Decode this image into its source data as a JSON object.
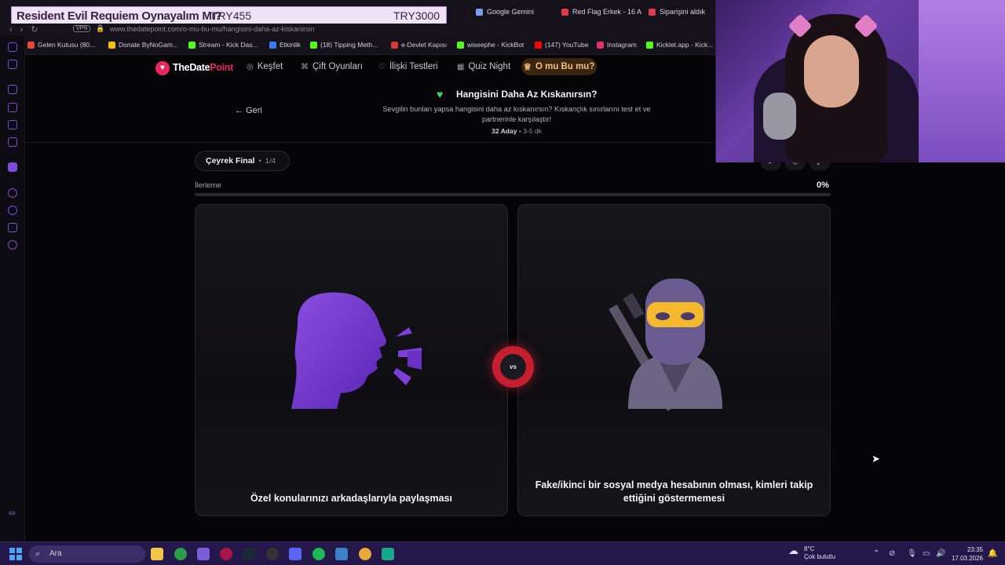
{
  "stream_overlay": {
    "title": "Resident Evil Requiem Oynayalım Mı?",
    "min_amount": "TRY455",
    "max_amount": "TRY3000"
  },
  "browser": {
    "tabs": [
      {
        "label": "Google Gemini",
        "color": "#7b9cf2"
      },
      {
        "label": "Red Flag Erkek - 16 A",
        "color": "#e03a4e"
      },
      {
        "label": "Siparişini aldık",
        "color": "#e03a4e"
      }
    ],
    "vpn": "VPN",
    "url": "www.thedatepoint.com/o-mu-bu-mu/hangisini-daha-az-kiskanirsin",
    "bookmarks": [
      {
        "label": "Gelen Kutusu (80...",
        "color": "#e24b3b"
      },
      {
        "label": "Donate ByNoGam...",
        "color": "#f2c200"
      },
      {
        "label": "Stream - Kick Das...",
        "color": "#53fc18"
      },
      {
        "label": "Etkinlik",
        "color": "#3a7bf0"
      },
      {
        "label": "(18) Tipping Meth...",
        "color": "#53fc18"
      },
      {
        "label": "e-Devlet Kapısı",
        "color": "#d23a3a"
      },
      {
        "label": "wiseephe - KickBot",
        "color": "#53fc18"
      },
      {
        "label": "(147) YouTube",
        "color": "#ff0000"
      },
      {
        "label": "Instagram",
        "color": "#e1306c"
      },
      {
        "label": "Kicklet.app - Kick...",
        "color": "#53fc18"
      }
    ]
  },
  "site": {
    "logo_a": "TheDate",
    "logo_b": "Point",
    "nav": [
      {
        "label": "Keşfet",
        "icon": "compass-icon"
      },
      {
        "label": "Çift Oyunları",
        "icon": "gamepad-icon"
      },
      {
        "label": "İlişki Testleri",
        "icon": "heart-icon"
      },
      {
        "label": "Quiz Night",
        "icon": "grid-icon"
      },
      {
        "label": "O mu Bu mu?",
        "icon": "trophy-icon"
      }
    ],
    "brand_color": "#e6285f"
  },
  "quiz": {
    "back_label": "Geri",
    "title": "Hangisini Daha Az Kıskanırsın?",
    "description": "Sevgilin bunları yapsa hangisini daha az kıskanırsın? Kıskançlık sınırlarını test et ve partnerinle karşılaştır!",
    "candidates": "32 Aday",
    "separator": "•",
    "duration": "3-5 dk",
    "round_name": "Çeyrek Final",
    "round_count": "1/4",
    "progress_label": "İlerleme",
    "progress_value": "0%",
    "progress_fraction": 0,
    "vs_label": "vs",
    "left_option": "Özel konularınızı arkadaşlarıyla paylaşması",
    "right_option": "Fake/ikinci bir sosyal medya hesabının olması, kimleri takip ettiğini göstermemesi",
    "left_icon": "speaking-head-icon",
    "right_icon": "ninja-icon"
  },
  "taskbar": {
    "search_placeholder": "Ara",
    "weather_temp": "8°C",
    "weather_desc": "Çok bulutlu",
    "time": "23:35",
    "date": "17.03.2026"
  }
}
